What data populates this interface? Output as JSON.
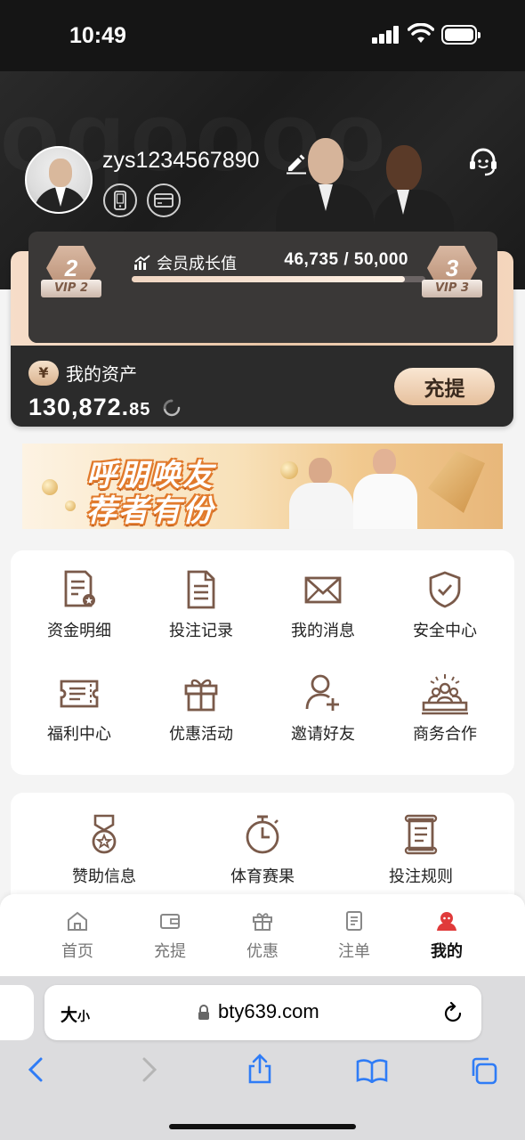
{
  "status_bar": {
    "time": "10:49"
  },
  "profile": {
    "username": "zys1234567890"
  },
  "vip": {
    "current_level": "2",
    "current_label": "VIP 2",
    "next_level": "3",
    "next_label": "VIP 3",
    "growth_label": "会员成长值",
    "growth_value": "46,735 / 50,000",
    "progress_fraction": 0.93
  },
  "assets": {
    "label": "我的资产",
    "currency_symbol": "¥",
    "amount_main": "130,872.",
    "amount_decimal": "85",
    "deposit_label": "充提"
  },
  "banner": {
    "line1": "呼朋唤友",
    "line2": "荐者有份"
  },
  "menu_primary": [
    {
      "label": "资金明细",
      "icon": "fund-details-icon"
    },
    {
      "label": "投注记录",
      "icon": "bet-record-icon"
    },
    {
      "label": "我的消息",
      "icon": "mail-icon"
    },
    {
      "label": "安全中心",
      "icon": "shield-icon"
    },
    {
      "label": "福利中心",
      "icon": "ticket-icon"
    },
    {
      "label": "优惠活动",
      "icon": "gift-icon"
    },
    {
      "label": "邀请好友",
      "icon": "add-user-icon"
    },
    {
      "label": "商务合作",
      "icon": "business-icon"
    }
  ],
  "menu_secondary": [
    {
      "label": "赞助信息",
      "icon": "medal-icon"
    },
    {
      "label": "体育赛果",
      "icon": "stopwatch-icon"
    },
    {
      "label": "投注规则",
      "icon": "scroll-icon"
    }
  ],
  "tab_bar": [
    {
      "label": "首页",
      "icon": "home-icon",
      "active": false
    },
    {
      "label": "充提",
      "icon": "wallet-icon",
      "active": false
    },
    {
      "label": "优惠",
      "icon": "gift-icon",
      "active": false
    },
    {
      "label": "注单",
      "icon": "list-icon",
      "active": false
    },
    {
      "label": "我的",
      "icon": "user-icon",
      "active": true
    }
  ],
  "browser": {
    "text_size_label": "大",
    "text_size_small": "小",
    "url": "bty639.com"
  },
  "colors": {
    "accent": "#e8c7a8",
    "dark": "#2b2b2b",
    "icon_brown": "#7a5a4a",
    "active_red": "#e03a3a"
  }
}
